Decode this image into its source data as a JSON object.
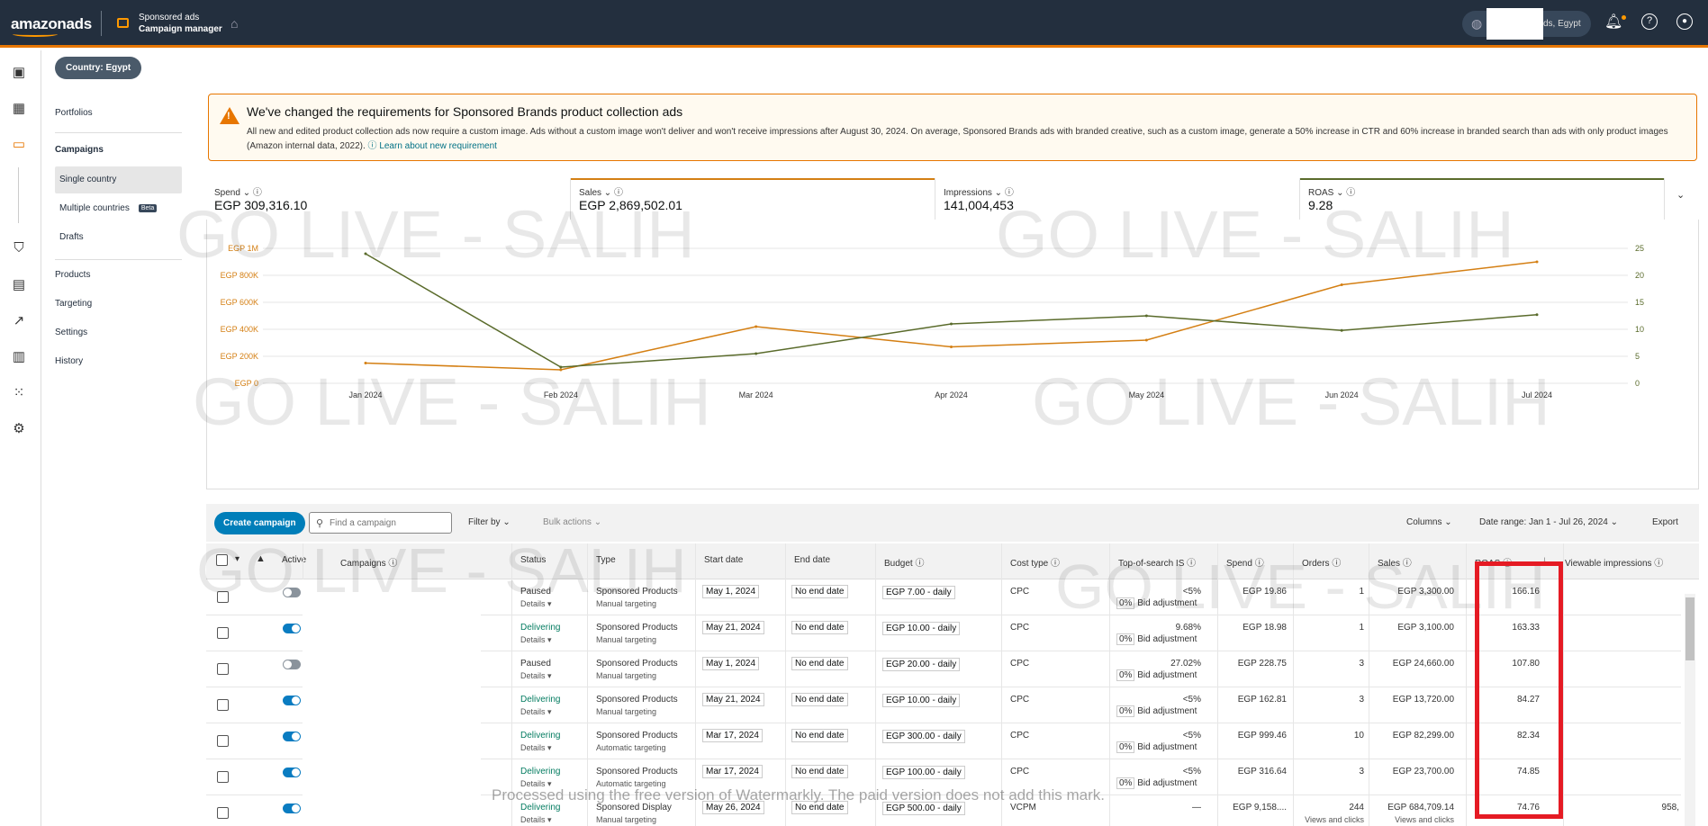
{
  "topbar": {
    "logo": "amazonads",
    "product_line1": "Sponsored ads",
    "product_line2": "Campaign manager",
    "account_text": "ds, Egypt"
  },
  "country_pill": "Country: Egypt",
  "subnav": {
    "portfolios": "Portfolios",
    "campaigns": "Campaigns",
    "single_country": "Single country",
    "multiple_countries": "Multiple countries",
    "beta": "Beta",
    "drafts": "Drafts",
    "products": "Products",
    "targeting": "Targeting",
    "settings": "Settings",
    "history": "History"
  },
  "banner": {
    "title": "We've changed the requirements for Sponsored Brands product collection ads",
    "text": "All new and edited product collection ads now require a custom image. Ads without a custom image won't deliver and won't receive impressions after August 30, 2024. On average, Sponsored Brands ads with branded creative, such as a custom image, generate a 50% increase in CTR and 60% increase in branded search than ads with only product images (Amazon internal data, 2022).",
    "link": "Learn about new requirement"
  },
  "metrics": [
    {
      "label": "Spend",
      "value": "EGP 309,316.10",
      "color": ""
    },
    {
      "label": "Sales",
      "value": "EGP 2,869,502.01",
      "color": "#d47f13"
    },
    {
      "label": "Impressions",
      "value": "141,004,453",
      "color": ""
    },
    {
      "label": "ROAS",
      "value": "9.28",
      "color": "#5a6b2b"
    }
  ],
  "watermark": "GO LIVE - SALIH",
  "chart_data": {
    "type": "line",
    "x": [
      "Jan 2024",
      "Feb 2024",
      "Mar 2024",
      "Apr 2024",
      "May 2024",
      "Jun 2024",
      "Jul 2024"
    ],
    "series": [
      {
        "name": "Sales",
        "axis": "left",
        "color": "#d47f13",
        "values": [
          150000,
          100000,
          420000,
          270000,
          320000,
          730000,
          900000
        ]
      },
      {
        "name": "ROAS",
        "axis": "right",
        "color": "#5a6b2b",
        "values": [
          24,
          3,
          5.5,
          11,
          12.5,
          9.8,
          12.7
        ]
      }
    ],
    "y_left_ticks": [
      "EGP 0",
      "EGP 200K",
      "EGP 400K",
      "EGP 600K",
      "EGP 800K",
      "EGP 1M"
    ],
    "y_left_lim": [
      0,
      1000000
    ],
    "y_right_ticks": [
      "0",
      "5",
      "10",
      "15",
      "20",
      "25"
    ],
    "y_right_lim": [
      0,
      25
    ],
    "grid": true
  },
  "toolbar": {
    "create": "Create campaign",
    "search_placeholder": "Find a campaign",
    "filter": "Filter by",
    "bulk": "Bulk actions",
    "columns": "Columns",
    "date_range": "Date range: Jan 1 - Jul 26, 2024",
    "export": "Export"
  },
  "table": {
    "headers": {
      "active": "Active",
      "campaigns": "Campaigns",
      "status": "Status",
      "type": "Type",
      "start": "Start date",
      "end": "End date",
      "budget": "Budget",
      "cost_type": "Cost type",
      "tos": "Top-of-search IS",
      "spend": "Spend",
      "orders": "Orders",
      "sales": "Sales",
      "roas": "ROAS",
      "viewable": "Viewable impressions"
    },
    "details": "Details",
    "bid_adj": "Bid adjustment",
    "rows": [
      {
        "status": "Paused",
        "type": "Sponsored Products",
        "targeting": "Manual targeting",
        "start": "May 1, 2024",
        "end": "No end date",
        "budget": "EGP 7.00 - daily",
        "cost": "CPC",
        "tos": "<5%",
        "bid": "0%",
        "spend": "EGP 19.86",
        "orders": "1",
        "sales": "EGP 3,300.00",
        "roas": "166.16",
        "on": false,
        "views": "",
        "viewable": ""
      },
      {
        "status": "Delivering",
        "type": "Sponsored Products",
        "targeting": "Manual targeting",
        "start": "May 21, 2024",
        "end": "No end date",
        "budget": "EGP 10.00 - daily",
        "cost": "CPC",
        "tos": "9.68%",
        "bid": "0%",
        "spend": "EGP 18.98",
        "orders": "1",
        "sales": "EGP 3,100.00",
        "roas": "163.33",
        "on": true,
        "views": "",
        "viewable": ""
      },
      {
        "status": "Paused",
        "type": "Sponsored Products",
        "targeting": "Manual targeting",
        "start": "May 1, 2024",
        "end": "No end date",
        "budget": "EGP 20.00 - daily",
        "cost": "CPC",
        "tos": "27.02%",
        "bid": "0%",
        "spend": "EGP 228.75",
        "orders": "3",
        "sales": "EGP 24,660.00",
        "roas": "107.80",
        "on": false,
        "views": "",
        "viewable": ""
      },
      {
        "status": "Delivering",
        "type": "Sponsored Products",
        "targeting": "Manual targeting",
        "start": "May 21, 2024",
        "end": "No end date",
        "budget": "EGP 10.00 - daily",
        "cost": "CPC",
        "tos": "<5%",
        "bid": "0%",
        "spend": "EGP 162.81",
        "orders": "3",
        "sales": "EGP 13,720.00",
        "roas": "84.27",
        "on": true,
        "views": "",
        "viewable": ""
      },
      {
        "status": "Delivering",
        "type": "Sponsored Products",
        "targeting": "Automatic targeting",
        "start": "Mar 17, 2024",
        "end": "No end date",
        "budget": "EGP 300.00 - daily",
        "cost": "CPC",
        "tos": "<5%",
        "bid": "0%",
        "spend": "EGP 999.46",
        "orders": "10",
        "sales": "EGP 82,299.00",
        "roas": "82.34",
        "on": true,
        "views": "",
        "viewable": ""
      },
      {
        "status": "Delivering",
        "type": "Sponsored Products",
        "targeting": "Automatic targeting",
        "start": "Mar 17, 2024",
        "end": "No end date",
        "budget": "EGP 100.00 - daily",
        "cost": "CPC",
        "tos": "<5%",
        "bid": "0%",
        "spend": "EGP 316.64",
        "orders": "3",
        "sales": "EGP 23,700.00",
        "roas": "74.85",
        "on": true,
        "views": "",
        "viewable": ""
      },
      {
        "status": "Delivering",
        "type": "Sponsored Display",
        "targeting": "Manual targeting",
        "start": "May 26, 2024",
        "end": "No end date",
        "budget": "EGP 500.00 - daily",
        "cost": "VCPM",
        "tos": "—",
        "bid": "",
        "spend": "EGP 9,158....",
        "orders": "244",
        "sales": "EGP 684,709.14",
        "roas": "74.76",
        "on": true,
        "views": "Views and clicks",
        "viewable": "958,"
      }
    ]
  },
  "bottom_watermark": "Processed using the free version of Watermarkly. The paid version does not add this mark."
}
